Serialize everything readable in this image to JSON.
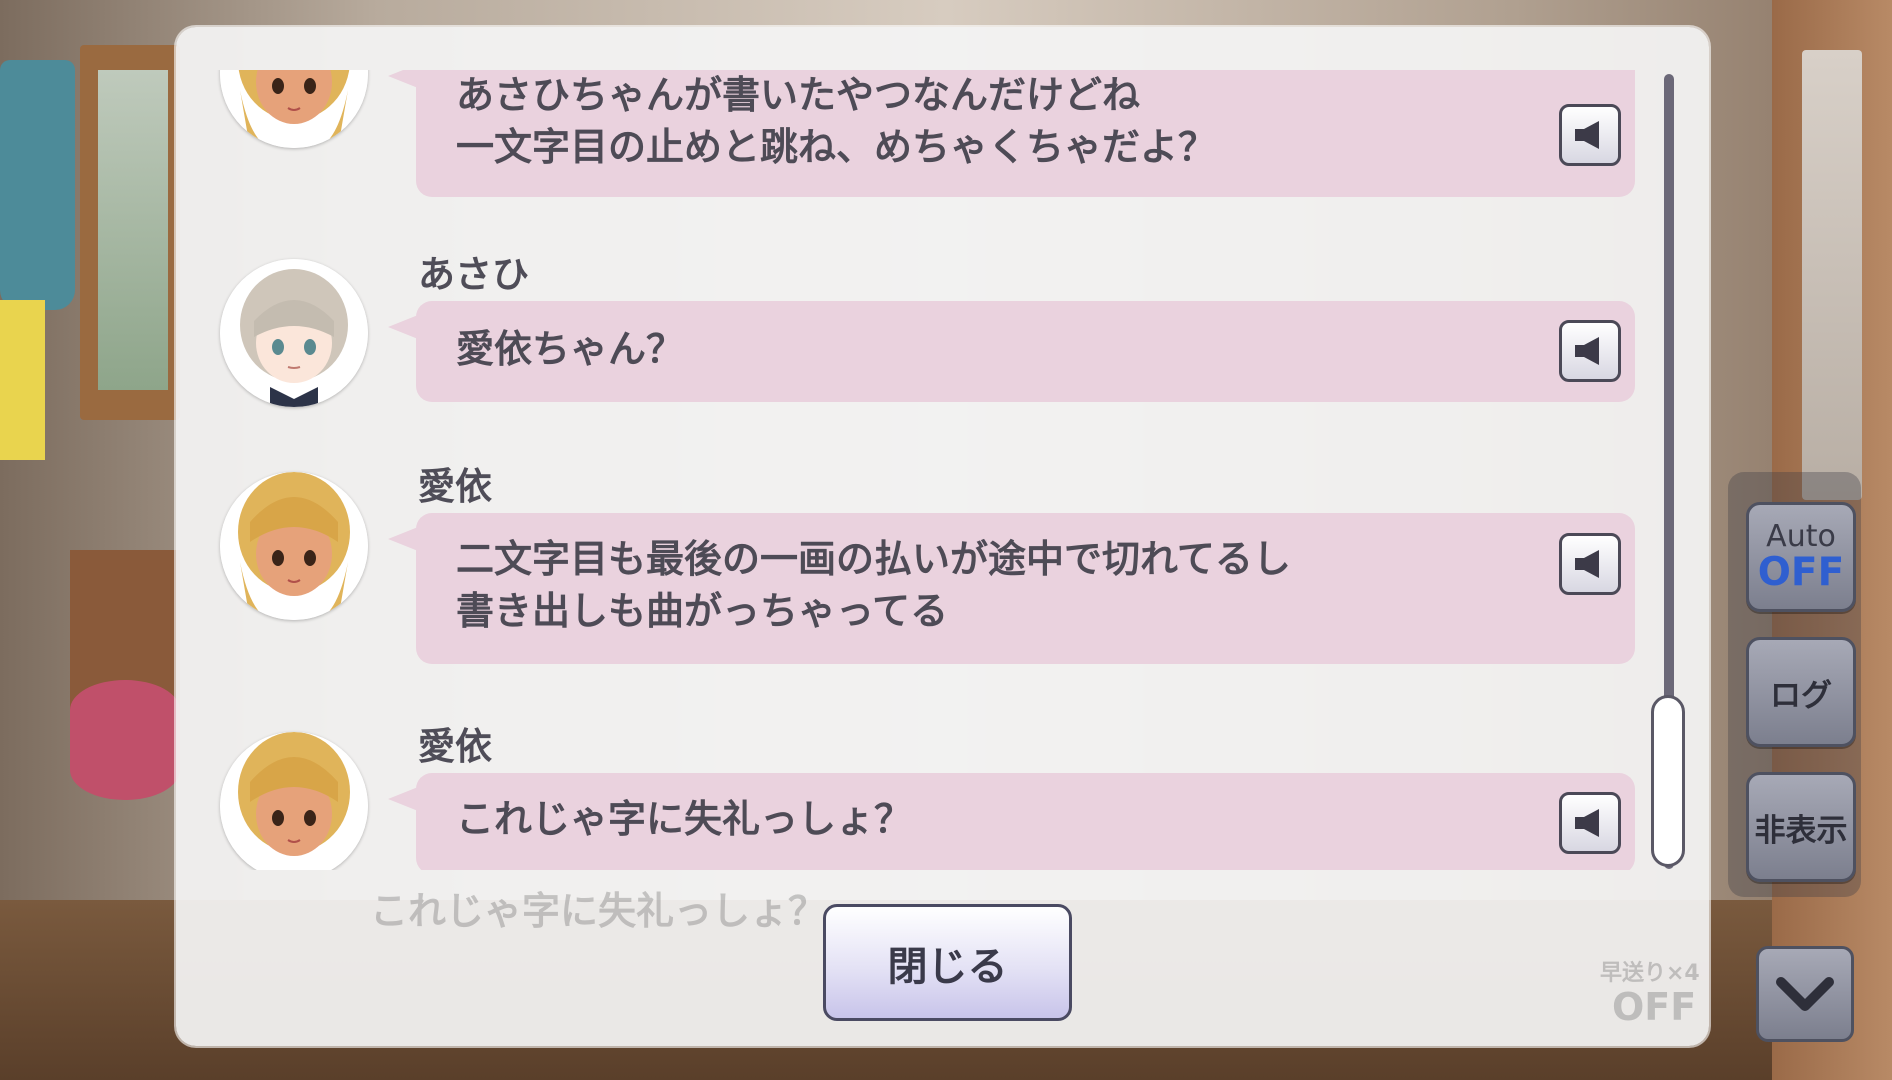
{
  "log": {
    "entries": [
      {
        "speaker": "",
        "avatar": "blonde-tan-girl-avatar",
        "text": "あさひちゃんが書いたやつなんだけどね\n一文字目の止めと跳ね、めちゃくちゃだよ？"
      },
      {
        "speaker": "あさひ",
        "avatar": "silver-hair-girl-avatar",
        "text": "愛依ちゃん？"
      },
      {
        "speaker": "愛依",
        "avatar": "blonde-tan-girl-avatar",
        "text": "二文字目も最後の一画の払いが途中で切れてるし\n書き出しも曲がっちゃってる"
      },
      {
        "speaker": "愛依",
        "avatar": "blonde-tan-girl-avatar",
        "text": "これじゃ字に失礼っしょ？"
      }
    ],
    "voice_icon": "speaker-icon",
    "close_label": "閉じる"
  },
  "background": {
    "faded_line": "これじゃ字に失礼っしょ？",
    "fast_forward_label": "早送り×4",
    "fast_forward_state": "OFF"
  },
  "controls": {
    "auto_label": "Auto",
    "auto_state": "OFF",
    "log_label": "ログ",
    "hide_label": "非表示",
    "next_icon": "chevron-down-icon"
  }
}
